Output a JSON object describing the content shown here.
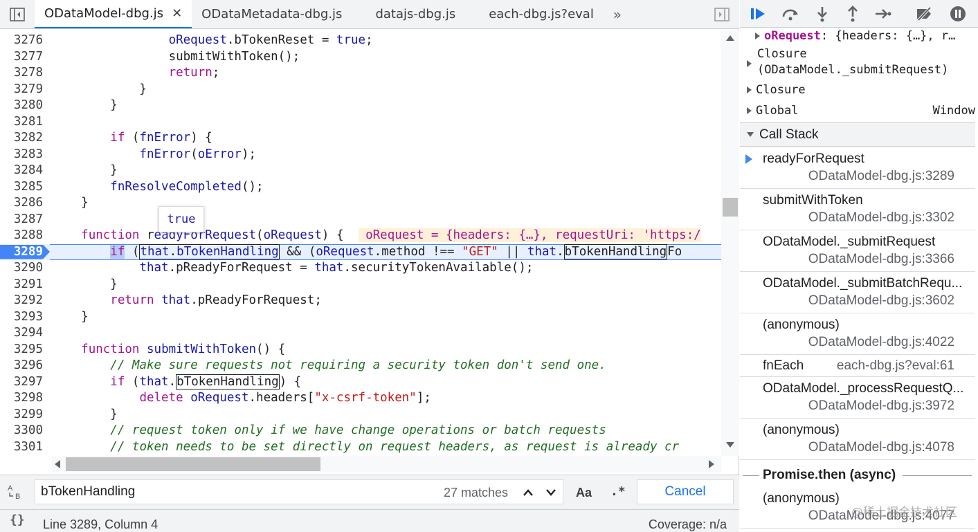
{
  "tabs": [
    {
      "label": "ODataModel-dbg.js",
      "active": true
    },
    {
      "label": "ODataMetadata-dbg.js",
      "active": false
    },
    {
      "label": "datajs-dbg.js",
      "active": false
    },
    {
      "label": "each-dbg.js?eval",
      "active": false
    }
  ],
  "editor": {
    "tooltip_value": "true",
    "inline_value": "oRequest = {headers: {…}, requestUri: 'https:/",
    "current_line": "3289",
    "lines": [
      {
        "n": "3276",
        "html": "                <span class='v'>oRequest</span>.bTokenReset = <span class='v'>true</span>;"
      },
      {
        "n": "3277",
        "html": "                submitWithToken();"
      },
      {
        "n": "3278",
        "html": "                <span class='k'>return</span>;"
      },
      {
        "n": "3279",
        "html": "            }"
      },
      {
        "n": "3280",
        "html": "        }"
      },
      {
        "n": "3281",
        "html": ""
      },
      {
        "n": "3282",
        "html": "        <span class='k'>if</span> (<span class='v'>fnError</span>) {"
      },
      {
        "n": "3283",
        "html": "            <span class='v'>fnError</span>(<span class='v'>oError</span>);"
      },
      {
        "n": "3284",
        "html": "        }"
      },
      {
        "n": "3285",
        "html": "        <span class='v'>fnResolveCompleted</span>();"
      },
      {
        "n": "3286",
        "html": "    }"
      },
      {
        "n": "3287",
        "html": ""
      },
      {
        "n": "3288",
        "html": "    <span class='k'>function</span> r<span class='v'>eadyForRequest</span>(<span class='v'>oRequest</span>) {  "
      },
      {
        "n": "3289",
        "html": "        <span class='k sel'>if</span> (<span class='hl'><span class='v'>that</span>.<span class='v'>bTokenHandling</span></span> &amp;&amp; (<span class='v'>oRequest</span>.method !== <span class='s'>\"GET\"</span> || <span class='v'>that</span>.<span class='hl'>bTokenHandling</span>Fo"
      },
      {
        "n": "3290",
        "html": "            <span class='v'>that</span>.pReadyForRequest = <span class='v'>that</span>.securityTokenAvailable();"
      },
      {
        "n": "3291",
        "html": "        }"
      },
      {
        "n": "3292",
        "html": "        <span class='k'>return</span> <span class='v'>that</span>.pReadyForRequest;"
      },
      {
        "n": "3293",
        "html": "    }"
      },
      {
        "n": "3294",
        "html": ""
      },
      {
        "n": "3295",
        "html": "    <span class='k'>function</span> <span class='v'>submitWithToken</span>() {"
      },
      {
        "n": "3296",
        "html": "        <span class='c'>// Make sure requests not requiring a security token don't send one.</span>"
      },
      {
        "n": "3297",
        "html": "        <span class='k'>if</span> (<span class='v'>that</span>.<span class='hl'>bTokenHandling</span>) {"
      },
      {
        "n": "3298",
        "html": "            <span class='k'>delete</span> <span class='v'>oRequest</span>.headers[<span class='s'>\"x-csrf-token\"</span>];"
      },
      {
        "n": "3299",
        "html": "        }"
      },
      {
        "n": "3300",
        "html": "        <span class='c'>// request token only if we have change operations or batch requests</span>"
      },
      {
        "n": "3301",
        "html": "        <span class='c'>// token needs to be set directly on request headers, as request is already cr</span>"
      },
      {
        "n": "3302",
        "html": ""
      }
    ]
  },
  "search": {
    "query": "bTokenHandling",
    "matches": "27 matches",
    "case_label": "Aa",
    "regex_label": ".*",
    "cancel_label": "Cancel"
  },
  "status": {
    "cursor": "Line 3289, Column 4",
    "coverage": "Coverage: n/a"
  },
  "scope": {
    "orequest_name": "oRequest",
    "orequest_preview": ": {headers: {…}, r…",
    "closure1_line1": "Closure",
    "closure1_line2": "(ODataModel._submitRequest)",
    "closure2": "Closure",
    "global": "Global",
    "global_value": "Window"
  },
  "callstack": {
    "header": "Call Stack",
    "frames": [
      {
        "name": "readyForRequest",
        "loc": "ODataModel-dbg.js:3289"
      },
      {
        "name": "submitWithToken",
        "loc": "ODataModel-dbg.js:3302"
      },
      {
        "name": "ODataModel._submitRequest",
        "loc": "ODataModel-dbg.js:3366"
      },
      {
        "name": "ODataModel._submitBatchRequ...",
        "loc": "ODataModel-dbg.js:3602"
      },
      {
        "name": "(anonymous)",
        "loc": "ODataModel-dbg.js:4022"
      },
      {
        "name": "fnEach",
        "loc": "each-dbg.js?eval:61"
      },
      {
        "name": "ODataModel._processRequestQ...",
        "loc": "ODataModel-dbg.js:3972"
      },
      {
        "name": "(anonymous)",
        "loc": "ODataModel-dbg.js:4078"
      },
      {
        "name": "(anonymous)",
        "loc": "ODataModel-dbg.js:4077"
      }
    ],
    "async_label": "Promise.then (async)"
  },
  "watermark": "@稀土掘金技术社区",
  "colors": {
    "accent": "#1a73e8",
    "keyword": "#a3158f",
    "identifier": "#1a1aa6",
    "string": "#c41a16",
    "comment": "#236e25",
    "exec_line_bg": "#e8f0fe"
  }
}
